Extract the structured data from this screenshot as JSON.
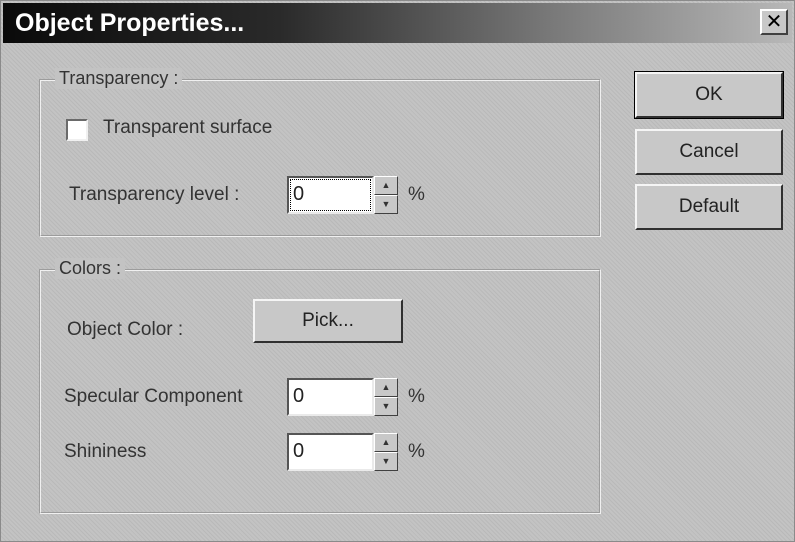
{
  "window": {
    "title": "Object Properties...",
    "close_glyph": "✕"
  },
  "transparency_group": {
    "legend": "Transparency :",
    "checkbox_label": "Transparent surface",
    "checkbox_checked": false,
    "level_label": "Transparency level :",
    "level_value": "0",
    "unit": "%"
  },
  "colors_group": {
    "legend": "Colors :",
    "object_color_label": "Object Color :",
    "pick_button": "Pick...",
    "specular_label": "Specular Component",
    "specular_value": "0",
    "shininess_label": "Shininess",
    "shininess_value": "0",
    "unit": "%"
  },
  "buttons": {
    "ok": "OK",
    "cancel": "Cancel",
    "default": "Default"
  },
  "icons": {
    "spin_up": "▲",
    "spin_down": "▼"
  }
}
